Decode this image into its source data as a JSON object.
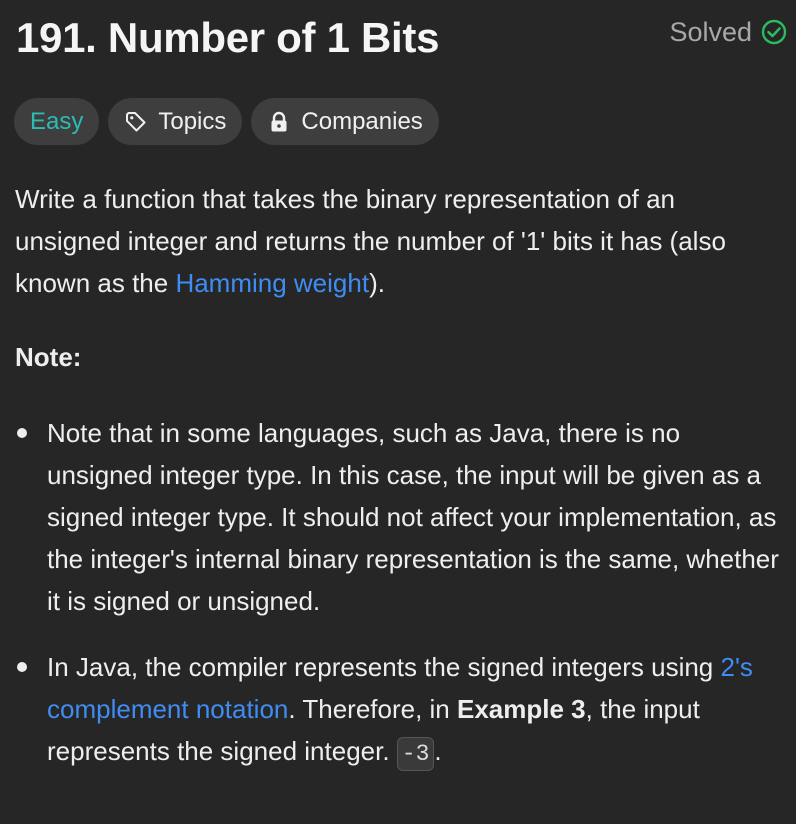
{
  "header": {
    "title": "191. Number of 1 Bits",
    "status": "Solved",
    "status_icon": "check-circle-icon",
    "status_color": "#2cbb5d"
  },
  "tags": {
    "difficulty": "Easy",
    "difficulty_color": "#2cbbb6",
    "topics": "Topics",
    "topics_icon": "tag-icon",
    "companies": "Companies",
    "companies_icon": "lock-icon"
  },
  "description": {
    "intro_part1": "Write a function that takes the binary representation of an unsigned integer and returns the number of '1' bits it has (also known as the ",
    "intro_link": "Hamming weight",
    "intro_part2": ").",
    "note_heading": "Note:",
    "bullets": [
      {
        "text": "Note that in some languages, such as Java, there is no unsigned integer type. In this case, the input will be given as a signed integer type. It should not affect your implementation, as the integer's internal binary representation is the same, whether it is signed or unsigned."
      },
      {
        "part1": "In Java, the compiler represents the signed integers using ",
        "link": "2's complement notation",
        "part2": ". Therefore, in ",
        "bold": "Example 3",
        "part3": ", the input represents the signed integer. ",
        "code": "-3",
        "part4": "."
      }
    ]
  },
  "colors": {
    "background": "#262626",
    "link": "#3f8df3",
    "pill_background": "#3e3e3e"
  }
}
